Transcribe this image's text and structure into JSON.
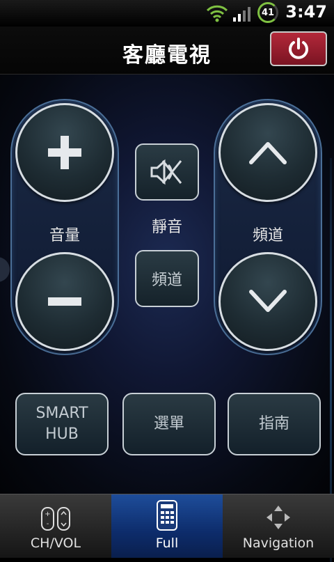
{
  "status_bar": {
    "time": "3:47",
    "battery": "41"
  },
  "header": {
    "title": "客廳電視"
  },
  "controls": {
    "volume_label": "音量",
    "mute_label": "靜音",
    "channel_small_label": "頻道",
    "channel_label": "頻道"
  },
  "menu_buttons": {
    "smart_hub": "SMART\nHUB",
    "menu": "選單",
    "guide": "指南"
  },
  "tabs": [
    {
      "label": "CH/VOL",
      "active": false
    },
    {
      "label": "Full",
      "active": true
    },
    {
      "label": "Navigation",
      "active": false
    }
  ],
  "colors": {
    "power": "#a21f31",
    "accent_tab": "#1e4d9a",
    "pill_border": "#4b6f97"
  }
}
